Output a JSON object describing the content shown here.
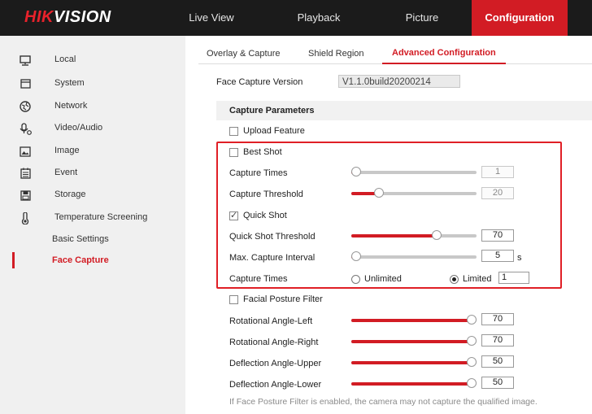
{
  "brand": {
    "logo_hik": "HIK",
    "logo_vision": "VISION"
  },
  "topnav": [
    {
      "label": "Live View"
    },
    {
      "label": "Playback"
    },
    {
      "label": "Picture"
    },
    {
      "label": "Configuration",
      "active": true
    }
  ],
  "sidebar": {
    "items": [
      {
        "label": "Local",
        "icon": "monitor-icon"
      },
      {
        "label": "System",
        "icon": "system-icon"
      },
      {
        "label": "Network",
        "icon": "network-icon"
      },
      {
        "label": "Video/Audio",
        "icon": "video-audio-icon"
      },
      {
        "label": "Image",
        "icon": "image-icon"
      },
      {
        "label": "Event",
        "icon": "event-icon"
      },
      {
        "label": "Storage",
        "icon": "storage-icon"
      },
      {
        "label": "Temperature Screening",
        "icon": "thermometer-icon"
      }
    ],
    "subitems": [
      {
        "label": "Basic Settings"
      },
      {
        "label": "Face Capture",
        "active": true
      }
    ]
  },
  "tabs": [
    {
      "label": "Overlay & Capture"
    },
    {
      "label": "Shield Region"
    },
    {
      "label": "Advanced Configuration",
      "active": true
    }
  ],
  "version": {
    "label": "Face Capture Version",
    "value": "V1.1.0build20200214"
  },
  "section_title": "Capture Parameters",
  "upload_feature": {
    "label": "Upload Feature",
    "checked": false
  },
  "best_shot": {
    "label": "Best Shot",
    "checked": false,
    "capture_times": {
      "label": "Capture Times",
      "value": "1",
      "fill_fraction": 0.0
    },
    "capture_threshold": {
      "label": "Capture Threshold",
      "value": "20",
      "fill_fraction": 0.2
    }
  },
  "quick_shot": {
    "label": "Quick Shot",
    "checked": true,
    "threshold": {
      "label": "Quick Shot Threshold",
      "value": "70",
      "fill_fraction": 0.7
    },
    "max_interval": {
      "label": "Max. Capture Interval",
      "value": "5",
      "unit": "s",
      "fill_fraction": 0.0
    },
    "capture_times": {
      "label": "Capture Times",
      "option_unlimited": "Unlimited",
      "option_limited": "Limited",
      "limited_value": "1",
      "selected": "Limited"
    }
  },
  "facial_posture": {
    "label": "Facial Posture Filter",
    "checked": false,
    "rows": [
      {
        "label": "Rotational Angle-Left",
        "value": "70",
        "fill_fraction": 1.0
      },
      {
        "label": "Rotational Angle-Right",
        "value": "70",
        "fill_fraction": 1.0
      },
      {
        "label": "Deflection Angle-Upper",
        "value": "50",
        "fill_fraction": 1.0
      },
      {
        "label": "Deflection Angle-Lower",
        "value": "50",
        "fill_fraction": 1.0
      }
    ],
    "note": "If Face Posture Filter is enabled, the camera may not capture the qualified image."
  },
  "colors": {
    "accent": "#d21c24",
    "topbar": "#1b1b1b",
    "sidebar": "#f0f0f0",
    "highlight_box": "#e01f26"
  }
}
